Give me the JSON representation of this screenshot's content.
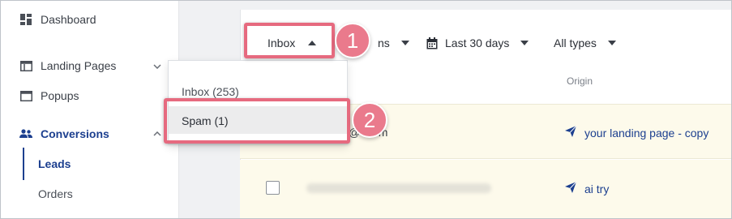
{
  "sidebar": {
    "items": [
      {
        "label": "Dashboard",
        "icon": "grid-icon"
      },
      {
        "label": "Landing Pages",
        "icon": "layout-icon"
      },
      {
        "label": "Popups",
        "icon": "window-icon"
      },
      {
        "label": "Conversions",
        "icon": "users-icon"
      }
    ],
    "subitems": [
      {
        "label": "Leads"
      },
      {
        "label": "Orders"
      }
    ]
  },
  "filters": {
    "inbox_label": "Inbox",
    "partial_label": "ns",
    "date_label": "Last 30 days",
    "types_label": "All types"
  },
  "columns": {
    "origin": "Origin"
  },
  "dropdown": {
    "items": [
      "Inbox (253)",
      "Spam (1)"
    ]
  },
  "rows": [
    {
      "email_tail": "@  .com",
      "origin": "your landing page - copy"
    },
    {
      "origin": "ai try"
    }
  ],
  "callouts": [
    "1",
    "2"
  ],
  "colors": {
    "accent": "#1c3f8f",
    "highlight": "#e66a7f",
    "badge": "#ea7a8c",
    "row_bg": "#fdfaeb"
  }
}
